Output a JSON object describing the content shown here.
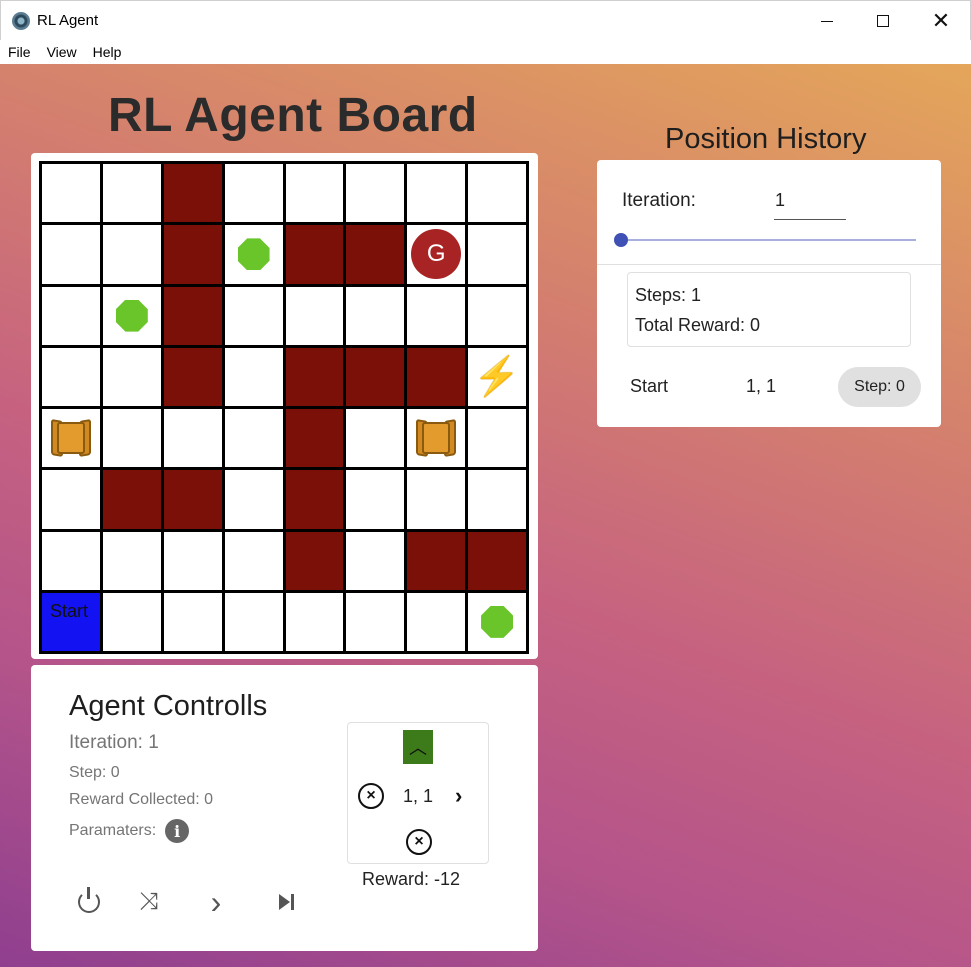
{
  "window": {
    "title": "RL Agent"
  },
  "menu": [
    "File",
    "View",
    "Help"
  ],
  "board": {
    "title": "RL Agent Board",
    "rows": 8,
    "cols": 8,
    "start_label": "Start",
    "goal_label": "G",
    "cells": [
      [
        "empty",
        "empty",
        "wall",
        "empty",
        "empty",
        "empty",
        "empty",
        "empty"
      ],
      [
        "empty",
        "empty",
        "wall",
        "gem",
        "wall",
        "wall",
        "goal",
        "empty"
      ],
      [
        "empty",
        "gem",
        "wall",
        "empty",
        "empty",
        "empty",
        "empty",
        "empty"
      ],
      [
        "empty",
        "empty",
        "wall",
        "empty",
        "wall",
        "wall",
        "wall",
        "bolt"
      ],
      [
        "chest",
        "empty",
        "empty",
        "empty",
        "wall",
        "empty",
        "chest",
        "empty"
      ],
      [
        "empty",
        "wall",
        "wall",
        "empty",
        "wall",
        "empty",
        "empty",
        "empty"
      ],
      [
        "empty",
        "empty",
        "empty",
        "empty",
        "wall",
        "empty",
        "wall",
        "wall"
      ],
      [
        "start",
        "empty",
        "empty",
        "empty",
        "empty",
        "empty",
        "empty",
        "gem"
      ]
    ],
    "colors": {
      "wall": "#7b1008",
      "start": "#1212f2",
      "goal": "#a82323",
      "gem": "#6ac52a"
    }
  },
  "controls": {
    "title": "Agent Controlls",
    "iteration": "Iteration: 1",
    "step": "Step: 0",
    "reward_collected": "Reward Collected: 0",
    "parameters": "Paramaters:",
    "position": "1, 1",
    "reward": "Reward: -12",
    "buttons": [
      "power-icon",
      "shuffle-icon",
      "chevron-right-icon",
      "skip-next-icon"
    ]
  },
  "history": {
    "title": "Position History",
    "iteration_label": "Iteration:",
    "iteration_value": "1",
    "slider_fraction": 0,
    "steps": "Steps: 1",
    "total_reward": "Total Reward: 0",
    "entry_label": "Start",
    "entry_position": "1, 1",
    "entry_step": "Step: 0"
  }
}
